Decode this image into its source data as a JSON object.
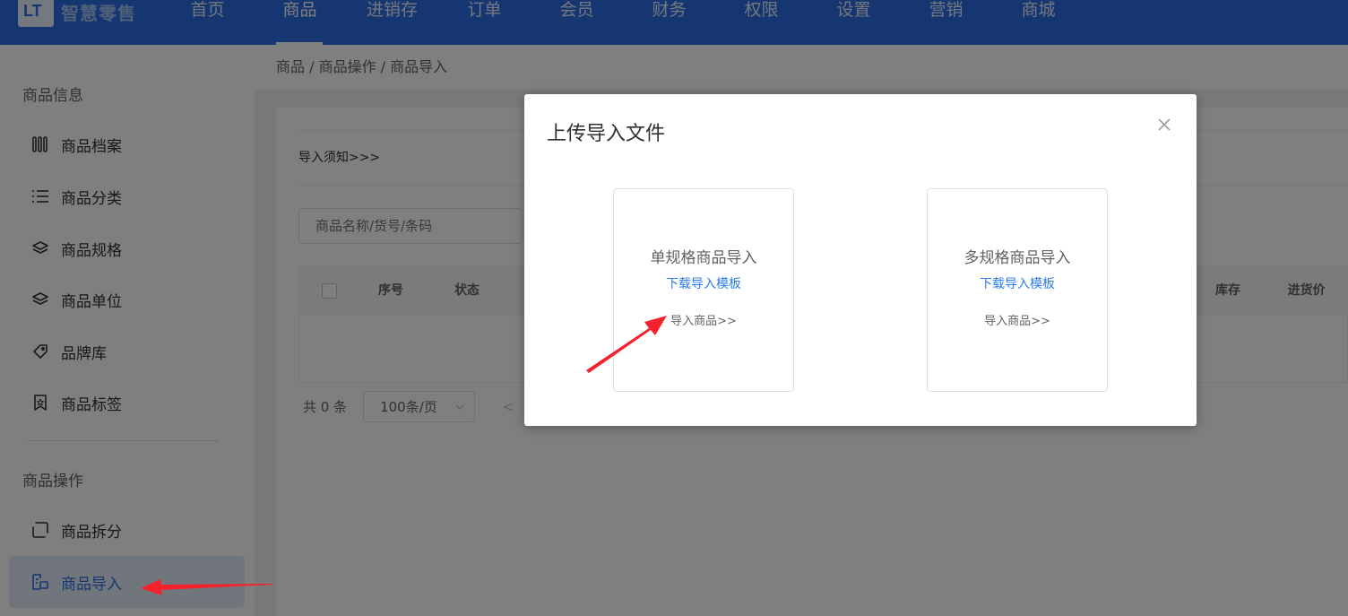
{
  "app": {
    "logo_text": "智慧零售"
  },
  "nav": {
    "items": [
      "首页",
      "商品",
      "进销存",
      "订单",
      "会员",
      "财务",
      "权限",
      "设置",
      "营销",
      "商城"
    ],
    "active_index": 1
  },
  "sidebar": {
    "group1": "商品信息",
    "items": [
      {
        "label": "商品档案",
        "icon": "barcode-icon"
      },
      {
        "label": "商品分类",
        "icon": "list-icon"
      },
      {
        "label": "商品规格",
        "icon": "layers-icon"
      },
      {
        "label": "商品单位",
        "icon": "layers-icon"
      },
      {
        "label": "品牌库",
        "icon": "tag-icon"
      },
      {
        "label": "商品标签",
        "icon": "badge-icon"
      }
    ],
    "group2": "商品操作",
    "items2": [
      {
        "label": "商品拆分",
        "icon": "split-icon"
      },
      {
        "label": "商品导入",
        "icon": "import-icon",
        "active": true
      }
    ]
  },
  "breadcrumb": "商品 / 商品操作 / 商品导入",
  "main": {
    "notice": "导入须知>>>",
    "search_placeholder": "商品名称/货号/条码",
    "columns": [
      "序号",
      "状态",
      "库存",
      "进货价"
    ],
    "pager": {
      "total": "共 0 条",
      "page_size": "100条/页",
      "prev": "<"
    }
  },
  "dialog": {
    "title": "上传导入文件",
    "cards": [
      {
        "title": "单规格商品导入",
        "download": "下载导入模板",
        "import": "导入商品>>"
      },
      {
        "title": "多规格商品导入",
        "download": "下载导入模板",
        "import": "导入商品>>"
      }
    ]
  },
  "colors": {
    "primary": "#2b6de0",
    "link": "#2b7de9",
    "annotation_arrow": "#f5222d"
  }
}
